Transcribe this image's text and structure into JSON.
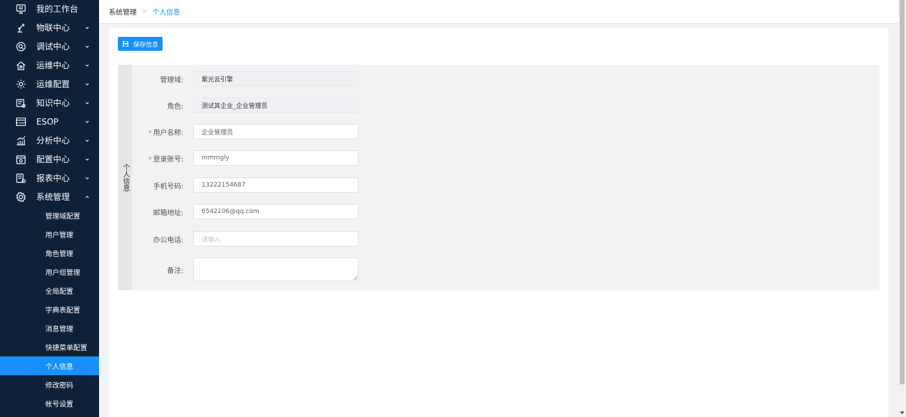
{
  "sidebar": {
    "items": [
      {
        "label": "我的工作台",
        "icon": "monitor-icon"
      },
      {
        "label": "物联中心",
        "icon": "robot-arm-icon"
      },
      {
        "label": "调试中心",
        "icon": "debug-icon"
      },
      {
        "label": "运维中心",
        "icon": "home-icon"
      },
      {
        "label": "运维配置",
        "icon": "gear-icon"
      },
      {
        "label": "知识中心",
        "icon": "knowledge-icon"
      },
      {
        "label": "ESOP",
        "icon": "esop-icon"
      },
      {
        "label": "分析中心",
        "icon": "analytics-icon"
      },
      {
        "label": "配置中心",
        "icon": "config-icon"
      },
      {
        "label": "报表中心",
        "icon": "report-icon"
      },
      {
        "label": "系统管理",
        "icon": "settings-icon"
      }
    ],
    "sub_items": [
      {
        "label": "管理域配置"
      },
      {
        "label": "用户管理"
      },
      {
        "label": "角色管理"
      },
      {
        "label": "用户组管理"
      },
      {
        "label": "全局配置"
      },
      {
        "label": "字典表配置"
      },
      {
        "label": "消息管理"
      },
      {
        "label": "快捷菜单配置"
      },
      {
        "label": "个人信息"
      },
      {
        "label": "修改密码"
      },
      {
        "label": "帐号设置"
      }
    ]
  },
  "breadcrumb": {
    "root": "系统管理",
    "separator": ">",
    "current": "个人信息"
  },
  "toolbar": {
    "save_label": "保存信息"
  },
  "form": {
    "section_title": "个人信息",
    "required_mark": "*",
    "fields": {
      "domain": {
        "label": "管理域:",
        "value": "紫光云引擎"
      },
      "role": {
        "label": "角色:",
        "value": "测试其企业_企业管理员"
      },
      "username": {
        "label": "用户名称:",
        "value": "企业管理员"
      },
      "account": {
        "label": "登录账号:",
        "value": "mmmgly"
      },
      "phone": {
        "label": "手机号码:",
        "value": "13222154687"
      },
      "email": {
        "label": "邮箱地址:",
        "value": "6542106@qq.com"
      },
      "office_phone": {
        "label": "办公电话:",
        "placeholder": "请输入"
      },
      "remark": {
        "label": "备注:"
      }
    }
  },
  "colors": {
    "sidebar_bg": "#0d2137",
    "accent": "#1890ff",
    "required": "#f56c6c"
  }
}
